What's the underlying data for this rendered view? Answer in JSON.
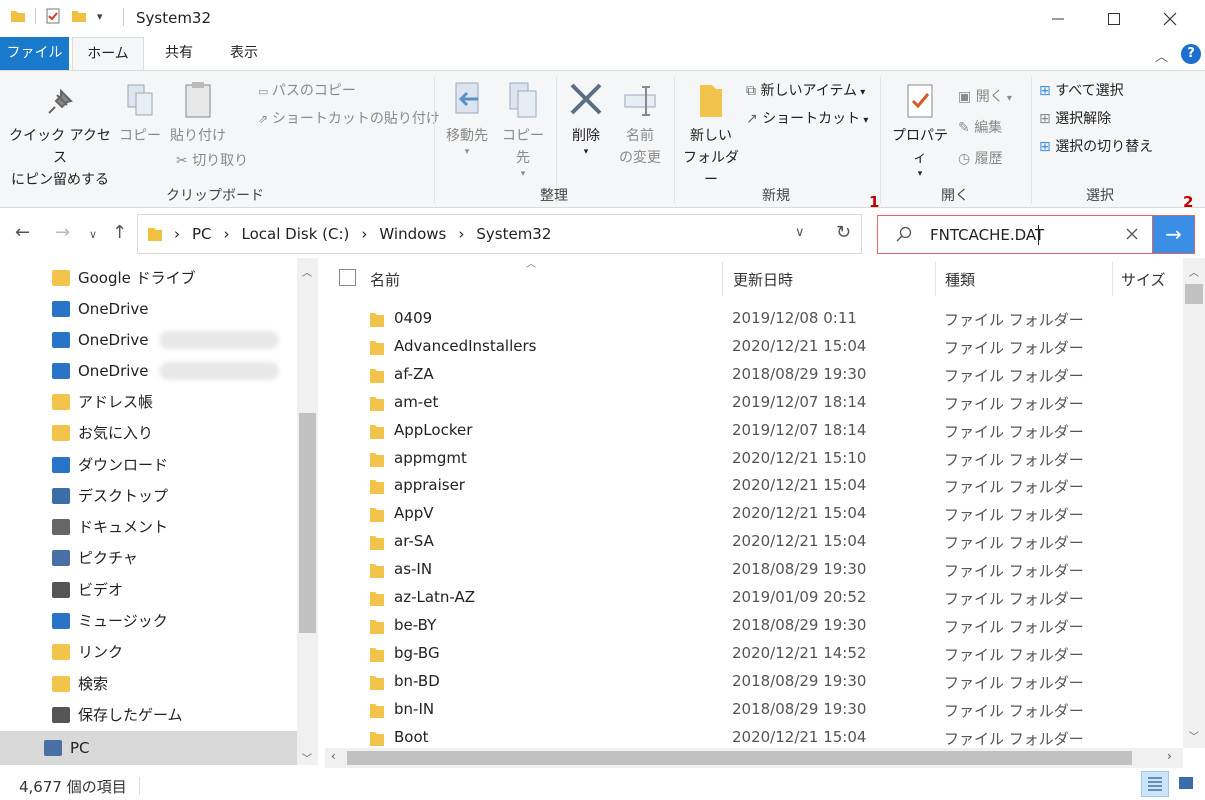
{
  "window": {
    "title": "System32"
  },
  "tabs": [
    {
      "label": "ファイル"
    },
    {
      "label": "ホーム"
    },
    {
      "label": "共有"
    },
    {
      "label": "表示"
    }
  ],
  "ribbon": {
    "clipboard": {
      "pin_label_1": "クイック アクセス",
      "pin_label_2": "にピン留めする",
      "copy": "コピー",
      "paste": "貼り付け",
      "copy_path": "パスのコピー",
      "paste_shortcut": "ショートカットの貼り付け",
      "cut": "切り取り",
      "group": "クリップボード"
    },
    "organize": {
      "move_to": "移動先",
      "copy_to": "コピー先",
      "delete": "削除",
      "rename_1": "名前",
      "rename_2": "の変更",
      "group": "整理"
    },
    "new": {
      "new_folder_1": "新しい",
      "new_folder_2": "フォルダー",
      "new_item": "新しいアイテム",
      "shortcut": "ショートカット",
      "group": "新規"
    },
    "open": {
      "properties": "プロパティ",
      "open": "開く",
      "edit": "編集",
      "history": "履歴",
      "group": "開く"
    },
    "select": {
      "select_all": "すべて選択",
      "select_none": "選択解除",
      "invert": "選択の切り替え",
      "group": "選択"
    }
  },
  "address": {
    "crumbs": [
      "PC",
      "Local Disk (C:)",
      "Windows",
      "System32"
    ]
  },
  "search": {
    "value": "FNTCACHE.DAT"
  },
  "markers": {
    "one": "1",
    "two": "2"
  },
  "nav": [
    {
      "label": "Google ドライブ"
    },
    {
      "label": "OneDrive"
    },
    {
      "label": "OneDrive"
    },
    {
      "label": "OneDrive"
    },
    {
      "label": "アドレス帳"
    },
    {
      "label": "お気に入り"
    },
    {
      "label": "ダウンロード"
    },
    {
      "label": "デスクトップ"
    },
    {
      "label": "ドキュメント"
    },
    {
      "label": "ピクチャ"
    },
    {
      "label": "ビデオ"
    },
    {
      "label": "ミュージック"
    },
    {
      "label": "リンク"
    },
    {
      "label": "検索"
    },
    {
      "label": "保存したゲーム"
    },
    {
      "label": "PC"
    }
  ],
  "columns": {
    "name": "名前",
    "date": "更新日時",
    "type": "種類",
    "size": "サイズ"
  },
  "files": [
    {
      "name": "0409",
      "date": "2019/12/08 0:11",
      "type": "ファイル フォルダー"
    },
    {
      "name": "AdvancedInstallers",
      "date": "2020/12/21 15:04",
      "type": "ファイル フォルダー"
    },
    {
      "name": "af-ZA",
      "date": "2018/08/29 19:30",
      "type": "ファイル フォルダー"
    },
    {
      "name": "am-et",
      "date": "2019/12/07 18:14",
      "type": "ファイル フォルダー"
    },
    {
      "name": "AppLocker",
      "date": "2019/12/07 18:14",
      "type": "ファイル フォルダー"
    },
    {
      "name": "appmgmt",
      "date": "2020/12/21 15:10",
      "type": "ファイル フォルダー"
    },
    {
      "name": "appraiser",
      "date": "2020/12/21 15:04",
      "type": "ファイル フォルダー"
    },
    {
      "name": "AppV",
      "date": "2020/12/21 15:04",
      "type": "ファイル フォルダー"
    },
    {
      "name": "ar-SA",
      "date": "2020/12/21 15:04",
      "type": "ファイル フォルダー"
    },
    {
      "name": "as-IN",
      "date": "2018/08/29 19:30",
      "type": "ファイル フォルダー"
    },
    {
      "name": "az-Latn-AZ",
      "date": "2019/01/09 20:52",
      "type": "ファイル フォルダー"
    },
    {
      "name": "be-BY",
      "date": "2018/08/29 19:30",
      "type": "ファイル フォルダー"
    },
    {
      "name": "bg-BG",
      "date": "2020/12/21 14:52",
      "type": "ファイル フォルダー"
    },
    {
      "name": "bn-BD",
      "date": "2018/08/29 19:30",
      "type": "ファイル フォルダー"
    },
    {
      "name": "bn-IN",
      "date": "2018/08/29 19:30",
      "type": "ファイル フォルダー"
    },
    {
      "name": "Boot",
      "date": "2020/12/21 15:04",
      "type": "ファイル フォルダー"
    }
  ],
  "status": {
    "count": "4,677 個の項目"
  }
}
